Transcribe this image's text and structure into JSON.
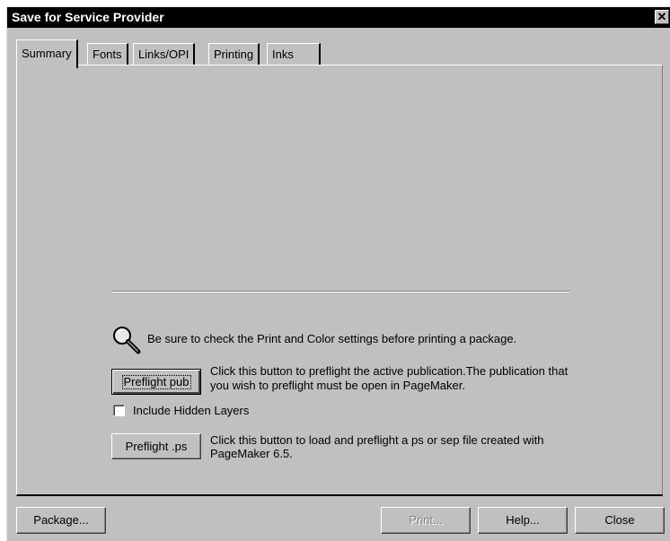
{
  "window": {
    "title": "Save for Service Provider",
    "close_glyph": "✕"
  },
  "tabs": [
    {
      "label": "Summary",
      "selected": true
    },
    {
      "label": "Fonts",
      "selected": false
    },
    {
      "label": "Links/OPI",
      "selected": false
    },
    {
      "label": "Printing",
      "selected": false
    },
    {
      "label": "Inks",
      "selected": false
    }
  ],
  "summary": {
    "icon": "magnifier-icon",
    "notice": "Be sure to check the Print and Color settings before printing a package.",
    "preflight_pub_label": "Preflight pub",
    "preflight_pub_desc_1": "Click this button to preflight the active publication.The publication that",
    "preflight_pub_desc_2": "you wish to preflight must be open in PageMaker.",
    "hidden_layers_label": "Include Hidden Layers",
    "hidden_layers_checked": false,
    "preflight_ps_label": "Preflight .ps",
    "preflight_ps_desc_1": "Click this button to load and preflight a ps or sep file created with",
    "preflight_ps_desc_2": "PageMaker 6.5."
  },
  "footer": {
    "package_label": "Package...",
    "print_label": "Print...",
    "print_enabled": false,
    "help_label": "Help...",
    "close_label": "Close"
  }
}
